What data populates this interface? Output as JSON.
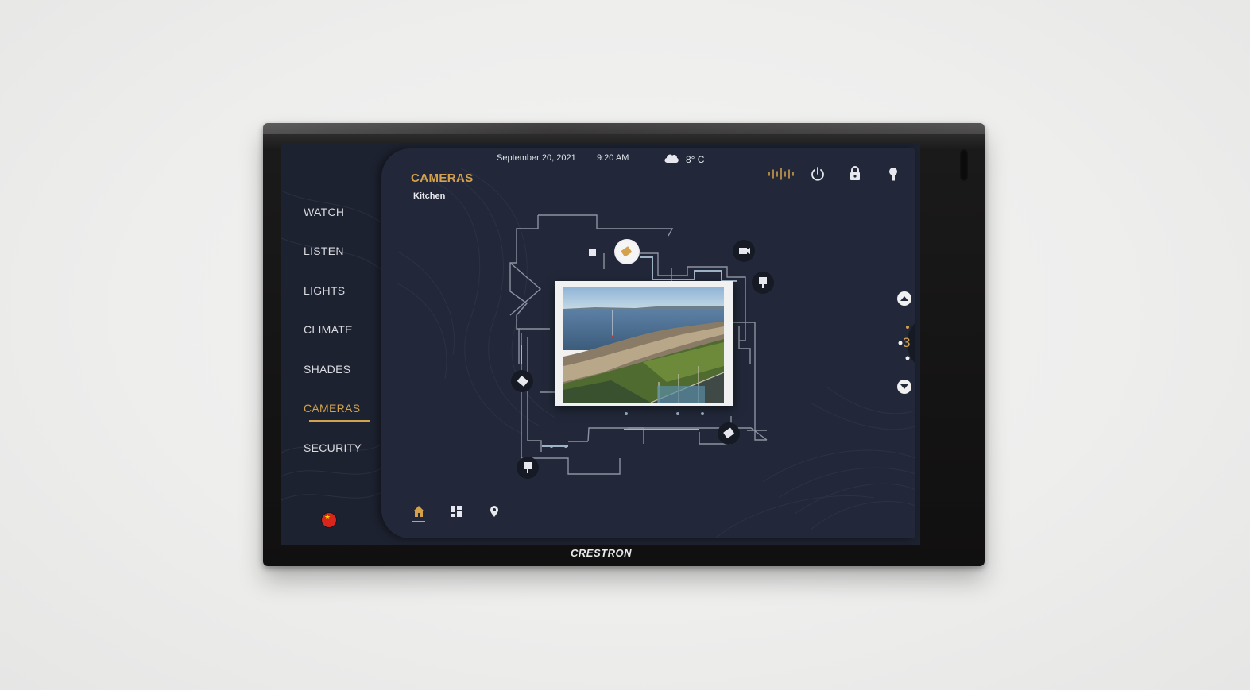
{
  "device": {
    "brand": "CRESTRON"
  },
  "nav": {
    "items": [
      {
        "label": "WATCH",
        "active": false
      },
      {
        "label": "LISTEN",
        "active": false
      },
      {
        "label": "LIGHTS",
        "active": false
      },
      {
        "label": "CLIMATE",
        "active": false
      },
      {
        "label": "SHADES",
        "active": false
      },
      {
        "label": "CAMERAS",
        "active": true
      },
      {
        "label": "SECURITY",
        "active": false
      }
    ],
    "language_icon": "china-flag-icon"
  },
  "status": {
    "date": "September 20, 2021",
    "time": "9:20 AM",
    "weather_icon": "cloud-icon",
    "temperature": "8° C"
  },
  "header": {
    "title": "CAMERAS",
    "subtitle": "Kitchen"
  },
  "top_icons": [
    "audio-wave-icon",
    "power-icon",
    "lock-icon",
    "lightbulb-icon"
  ],
  "floorplan": {
    "camera_markers": [
      "camera-marker-top",
      "camera-marker-topright",
      "camera-marker-right",
      "camera-marker-left",
      "camera-marker-bottomright",
      "camera-marker-bottomleft"
    ]
  },
  "pager": {
    "current_page": "3",
    "up_icon": "chevron-up-icon",
    "down_icon": "chevron-down-icon"
  },
  "bottom_nav": {
    "items": [
      "home-icon",
      "grid-icon",
      "location-pin-icon"
    ],
    "active": "home-icon"
  },
  "colors": {
    "accent": "#d4a24c",
    "background": "#1d2230",
    "panel": "#222839",
    "text": "#d9dbe0"
  }
}
